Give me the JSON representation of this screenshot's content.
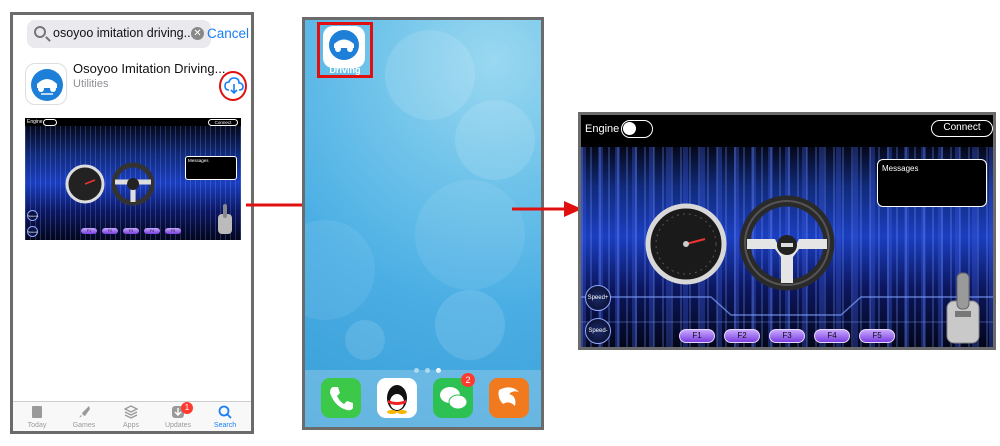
{
  "panel1": {
    "search": {
      "query": "osoyoo imitation driving...",
      "cancel": "Cancel"
    },
    "app": {
      "name": "Osoyoo Imitation Driving...",
      "category": "Utilities"
    },
    "tabs": [
      {
        "label": "Today",
        "icon": "today-icon"
      },
      {
        "label": "Games",
        "icon": "rocket-icon"
      },
      {
        "label": "Apps",
        "icon": "stack-icon"
      },
      {
        "label": "Updates",
        "icon": "download-icon",
        "badge": "1"
      },
      {
        "label": "Search",
        "icon": "search-icon"
      }
    ],
    "active_tab": "Search"
  },
  "panel2": {
    "app_label": "Driving",
    "dock": [
      {
        "name": "phone-app",
        "color": "#3cc94a"
      },
      {
        "name": "qq-app",
        "color": "#ffffff"
      },
      {
        "name": "wechat-app",
        "color": "#2dc153",
        "badge": "2"
      },
      {
        "name": "uc-browser-app",
        "color": "#f27a1e"
      }
    ]
  },
  "game": {
    "engine_label": "Engine",
    "connect_label": "Connect",
    "messages_label": "Messages",
    "speed_up_label": "Speed+",
    "speed_down_label": "Speed-",
    "function_buttons": [
      "F1",
      "F2",
      "F3",
      "F4",
      "F5"
    ]
  },
  "colors": {
    "highlight": "#e01010",
    "accent": "#1a7ef5",
    "arrow": "#e01010"
  }
}
